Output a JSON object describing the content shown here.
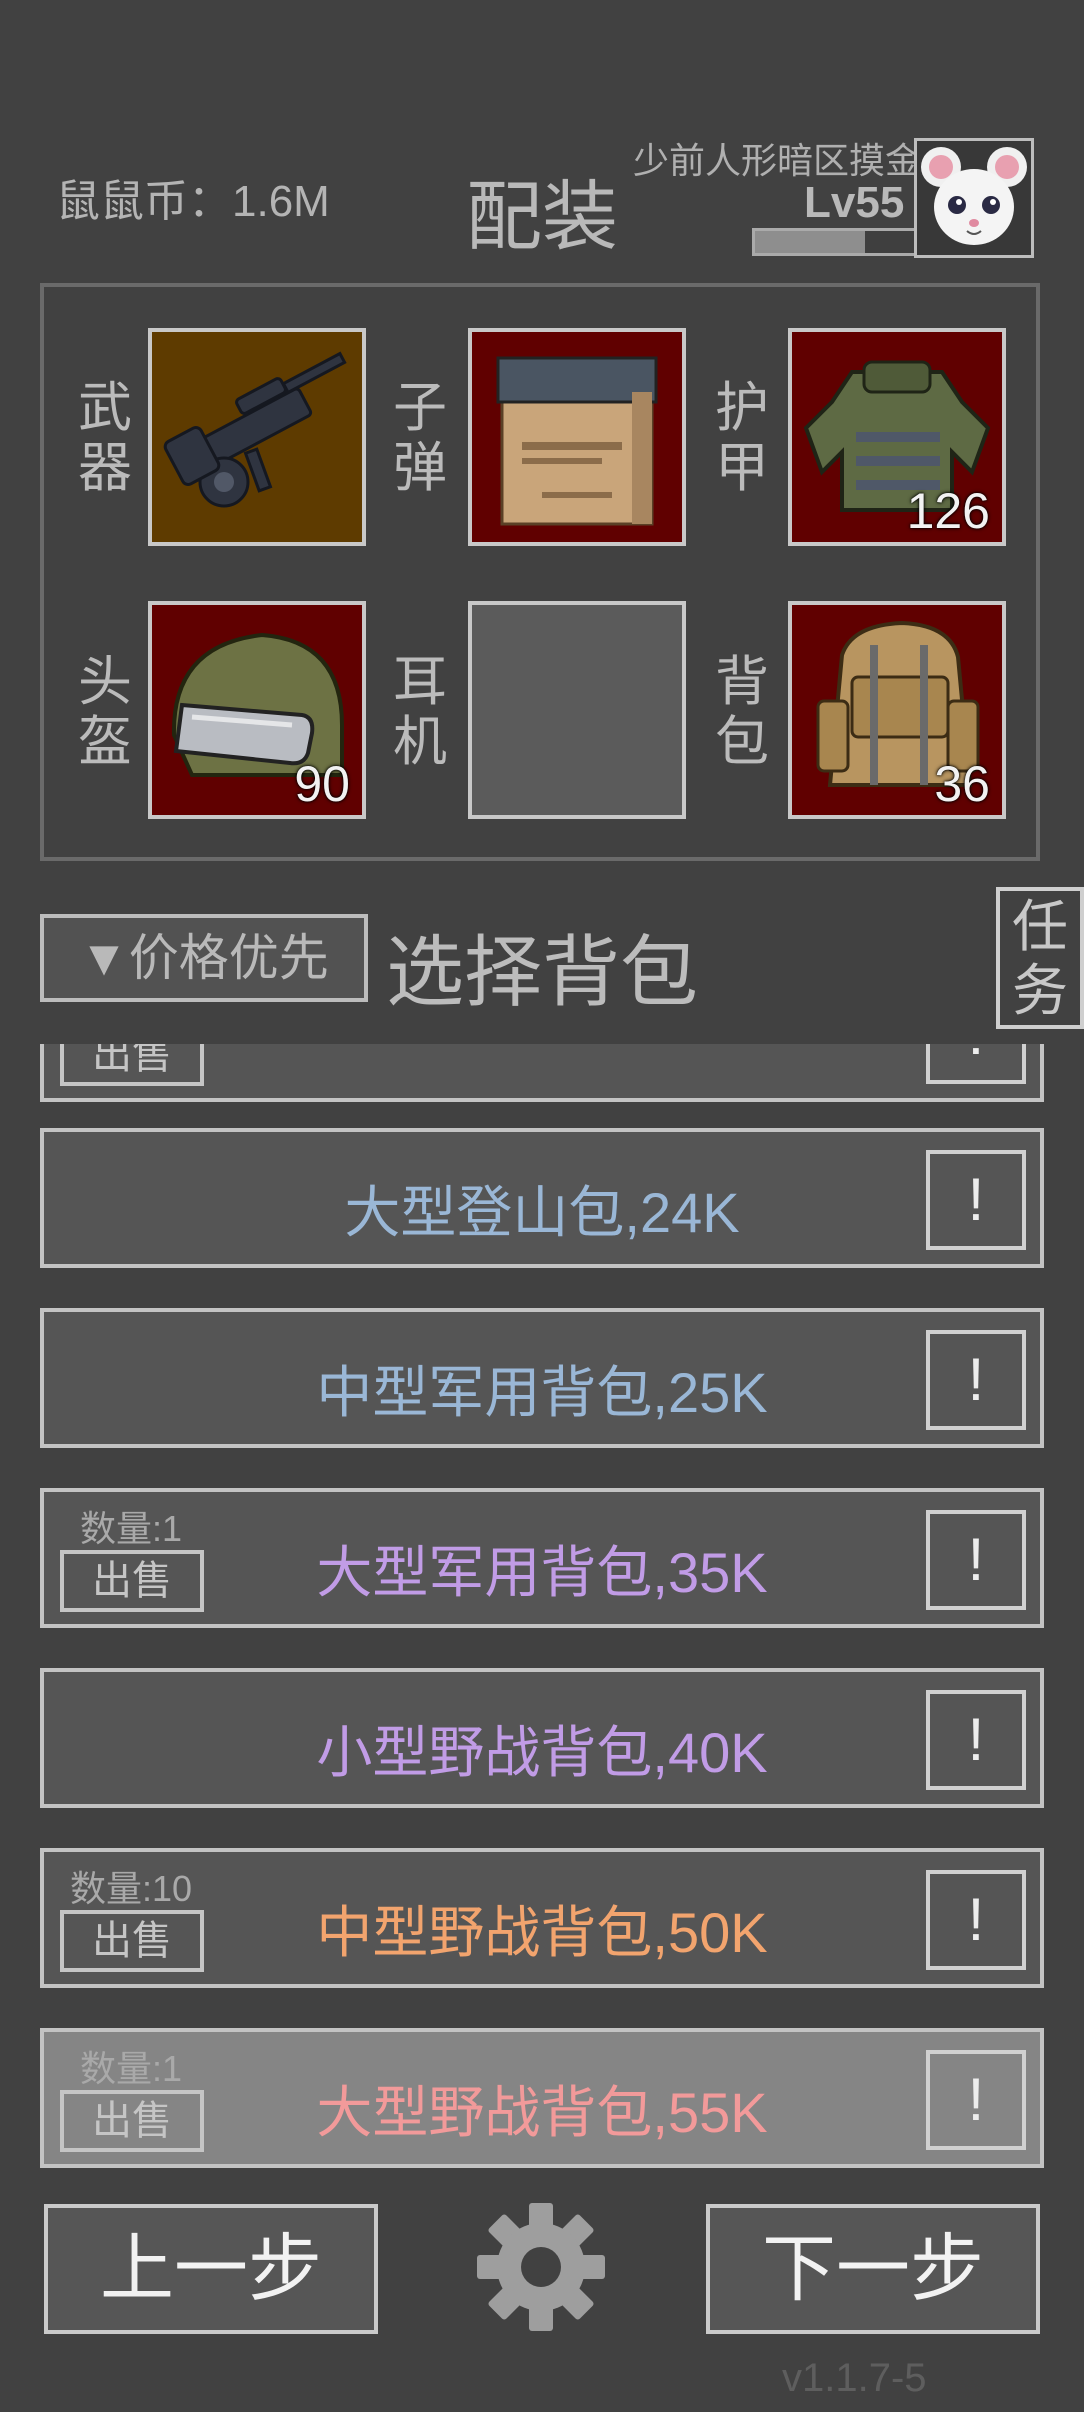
{
  "header": {
    "currency": "鼠鼠币：1.6M",
    "title": "配装",
    "player_name": "少前人形暗区摸金",
    "player_level": "Lv55",
    "xp_progress": 0.68
  },
  "equipment": [
    {
      "label": "武器",
      "icon": "machine-gun-icon",
      "bg": "#5e3b00",
      "durability": ""
    },
    {
      "label": "子弹",
      "icon": "ammo-box-icon",
      "bg": "#600000",
      "durability": ""
    },
    {
      "label": "护甲",
      "icon": "body-armor-icon",
      "bg": "#600000",
      "durability": "126"
    },
    {
      "label": "头盔",
      "icon": "helmet-icon",
      "bg": "#600000",
      "durability": "90"
    },
    {
      "label": "耳机",
      "icon": "",
      "bg": "#5b5b5b",
      "durability": ""
    },
    {
      "label": "背包",
      "icon": "backpack-icon",
      "bg": "#600000",
      "durability": "36"
    }
  ],
  "filter": {
    "sort_label": "▼价格优先",
    "section_title": "选择背包",
    "task_label": "任务"
  },
  "backpack_list": [
    {
      "name": "",
      "color": "#9ab7d6",
      "qty": "",
      "sell": "出售",
      "info": "!"
    },
    {
      "name": "大型登山包,24K",
      "color": "#9ab7d6",
      "qty": "",
      "sell": "",
      "info": "!"
    },
    {
      "name": "中型军用背包,25K",
      "color": "#9ab7d6",
      "qty": "",
      "sell": "",
      "info": "!"
    },
    {
      "name": "大型军用背包,35K",
      "color": "#c19ce6",
      "qty": "数量:1",
      "sell": "出售",
      "info": "!"
    },
    {
      "name": "小型野战背包,40K",
      "color": "#c19ce6",
      "qty": "",
      "sell": "",
      "info": "!"
    },
    {
      "name": "中型野战背包,50K",
      "color": "#f2a46e",
      "qty": "数量:10",
      "sell": "出售",
      "info": "!"
    },
    {
      "name": "大型野战背包,55K",
      "color": "#f29a9a",
      "qty": "数量:1",
      "sell": "出售",
      "info": "!"
    }
  ],
  "footer": {
    "prev_label": "上一步",
    "next_label": "下一步",
    "version": "v1.1.7-5"
  }
}
